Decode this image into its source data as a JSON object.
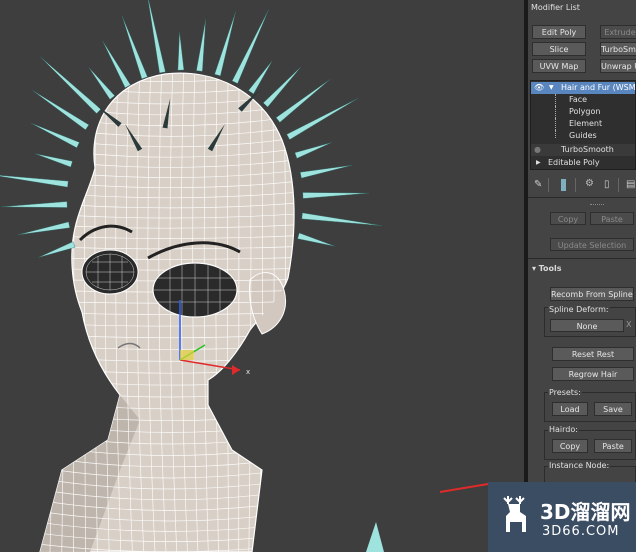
{
  "modifier_list": {
    "label": "Modifier List",
    "buttons": [
      "Edit Poly",
      "Extrude",
      "Slice",
      "TurboSmooth",
      "UVW Map",
      "Unwrap UVW"
    ]
  },
  "stack": {
    "items": [
      {
        "label": "Hair and Fur (WSM)",
        "selected": true
      },
      {
        "label": "Face",
        "selected": false
      },
      {
        "label": "Polygon",
        "selected": false
      },
      {
        "label": "Element",
        "selected": false
      },
      {
        "label": "Guides",
        "selected": false
      },
      {
        "label": "TurboSmooth",
        "selected": false
      },
      {
        "label": "Editable Poly",
        "selected": false
      }
    ]
  },
  "selection_rollout": {
    "copy_label": "Copy",
    "paste_label": "Paste",
    "update_selection_label": "Update Selection"
  },
  "tools": {
    "title": "Tools",
    "recomb_label": "Recomb From Splines",
    "spline_deform_label": "Spline Deform:",
    "none_label": "None",
    "clear_label": "X",
    "reset_rest_label": "Reset Rest",
    "regrow_hair_label": "Regrow Hair",
    "presets_label": "Presets:",
    "load_label": "Load",
    "save_label": "Save",
    "hairdo_label": "Hairdo:",
    "hairdo_copy_label": "Copy",
    "hairdo_paste_label": "Paste",
    "instance_node_label": "Instance Node:"
  },
  "viewport": {
    "gizmo_axis_label": "x"
  },
  "watermark": {
    "brand_cn": "3D溜溜网",
    "url": "3D66.COM"
  },
  "colors": {
    "viewport_bg": "#3e3e3e",
    "panel_bg": "#444444",
    "selection_blue": "#5a86c0",
    "spike_cyan": "#9fe3df",
    "wire_white": "#ffffff",
    "arrow_red": "#e02a2a"
  }
}
